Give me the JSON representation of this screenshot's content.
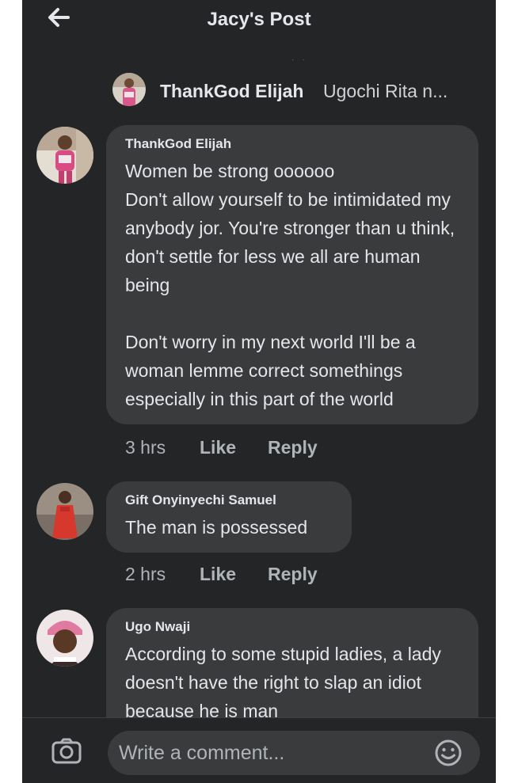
{
  "header": {
    "title": "Jacy's Post"
  },
  "reply_context": {
    "name": "ThankGod Elijah",
    "preview": "Ugochi Rita n..."
  },
  "comments": [
    {
      "author": "ThankGod Elijah",
      "text": "Women be strong oooooo\nDon't allow yourself to be intimidated my anybody jor. You're stronger than u think, don't settle for less we all are human being\n\nDon't worry in my next world I'll be a woman lemme correct somethings especially in this part of the world",
      "time": "3 hrs",
      "like_label": "Like",
      "reply_label": "Reply"
    },
    {
      "author": "Gift Onyinyechi Samuel",
      "text": "The man is possessed",
      "time": "2 hrs",
      "like_label": "Like",
      "reply_label": "Reply"
    },
    {
      "author": "Ugo Nwaji",
      "text": "According to some stupid ladies, a lady doesn't have the right to slap an idiot because he is man"
    }
  ],
  "composer": {
    "placeholder": "Write a comment..."
  },
  "colors": {
    "background": "#242526",
    "bubble": "#3a3b3c",
    "text": "#e4e6eb",
    "muted": "#b0b3b8"
  }
}
